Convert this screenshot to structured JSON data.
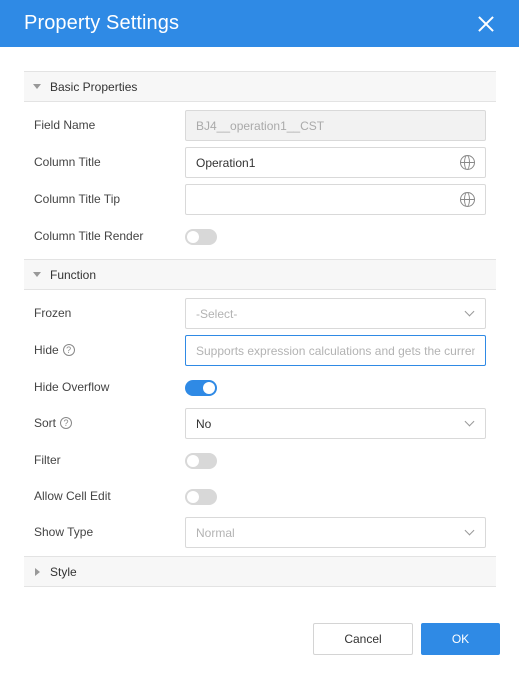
{
  "dialog": {
    "title": "Property Settings",
    "close_icon": "close-icon"
  },
  "sections": {
    "basic": {
      "label": "Basic Properties",
      "expanded": true
    },
    "function": {
      "label": "Function",
      "expanded": true
    },
    "style": {
      "label": "Style",
      "expanded": false
    }
  },
  "basic": {
    "field_name": {
      "label": "Field Name",
      "value": "BJ4__operation1__CST",
      "disabled": true
    },
    "column_title": {
      "label": "Column Title",
      "value": "Operation1",
      "icon": "globe-icon"
    },
    "column_title_tip": {
      "label": "Column Title Tip",
      "value": "",
      "icon": "globe-icon"
    },
    "column_title_render": {
      "label": "Column Title Render",
      "on": false
    }
  },
  "function": {
    "frozen": {
      "label": "Frozen",
      "value": "-Select-",
      "disabled": true
    },
    "hide": {
      "label": "Hide",
      "help": "?",
      "placeholder": "Supports expression calculations and gets the current"
    },
    "hide_overflow": {
      "label": "Hide Overflow",
      "on": true
    },
    "sort": {
      "label": "Sort",
      "help": "?",
      "value": "No"
    },
    "filter": {
      "label": "Filter",
      "on": false
    },
    "allow_cell_edit": {
      "label": "Allow Cell Edit",
      "on": false
    },
    "show_type": {
      "label": "Show Type",
      "value": "Normal",
      "disabled": true
    }
  },
  "footer": {
    "cancel_label": "Cancel",
    "ok_label": "OK"
  },
  "colors": {
    "accent": "#2f8ae5",
    "toggle_off": "#d8d8d8"
  }
}
